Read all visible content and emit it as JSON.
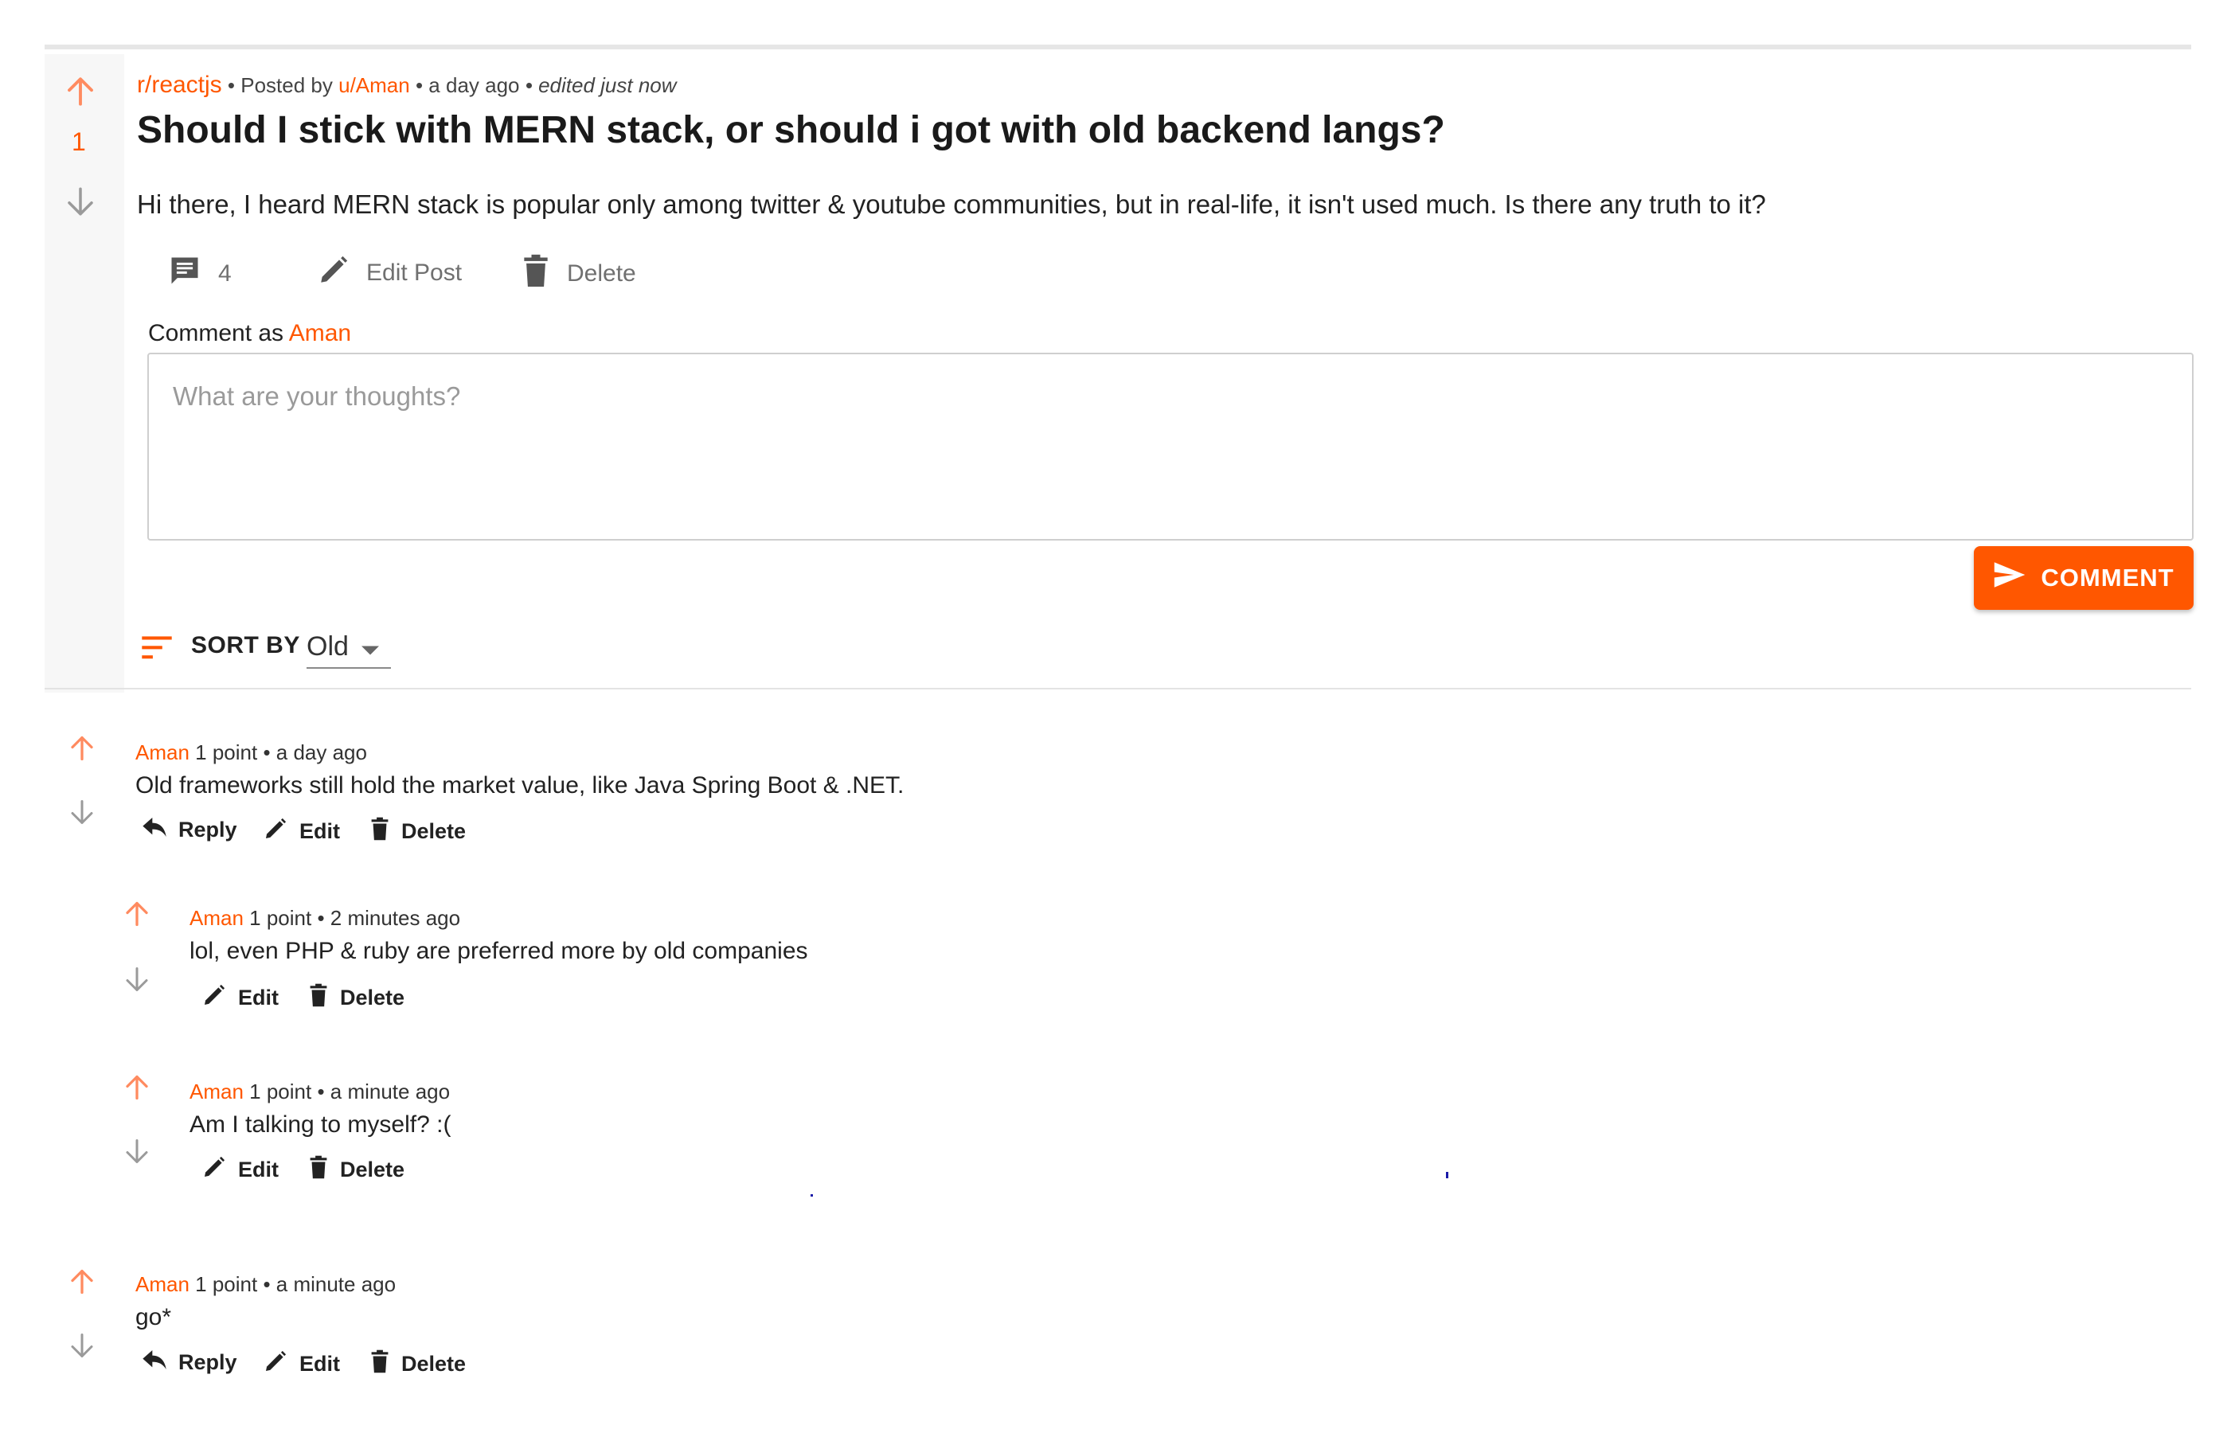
{
  "post": {
    "subreddit": "r/reactjs",
    "posted_by_prefix": "• Posted by",
    "author": "u/Aman",
    "time": "• a day ago",
    "edited": "• edited just now",
    "score": "1",
    "title": "Should I stick with MERN stack, or should i got with old backend langs?",
    "body": "Hi there, I heard MERN stack is popular only among twitter & youtube communities, but in real-life, it isn't used much. Is there any truth to it?",
    "comment_count": "4",
    "edit_label": "Edit Post",
    "delete_label": "Delete"
  },
  "composer": {
    "comment_as_label": "Comment as",
    "user": "Aman",
    "placeholder": "What are your thoughts?",
    "submit_label": "COMMENT"
  },
  "sort": {
    "label": "SORT BY",
    "value": "Old"
  },
  "comments": [
    {
      "author": "Aman",
      "meta": "1 point • a day ago",
      "text": "Old frameworks still hold the market value, like Java Spring Boot & .NET.",
      "reply_label": "Reply",
      "edit_label": "Edit",
      "delete_label": "Delete"
    },
    {
      "author": "Aman",
      "meta": "1 point • 2 minutes ago",
      "text": "lol, even PHP & ruby are preferred more by old companies",
      "edit_label": "Edit",
      "delete_label": "Delete"
    },
    {
      "author": "Aman",
      "meta": "1 point • a minute ago",
      "text": "Am I talking to myself? :(",
      "edit_label": "Edit",
      "delete_label": "Delete"
    },
    {
      "author": "Aman",
      "meta": "1 point • a minute ago",
      "text": "go*",
      "reply_label": "Reply",
      "edit_label": "Edit",
      "delete_label": "Delete"
    }
  ],
  "colors": {
    "accent": "#ff5700",
    "upvote": "#ff8b60",
    "downvote": "#9a9a9a"
  }
}
